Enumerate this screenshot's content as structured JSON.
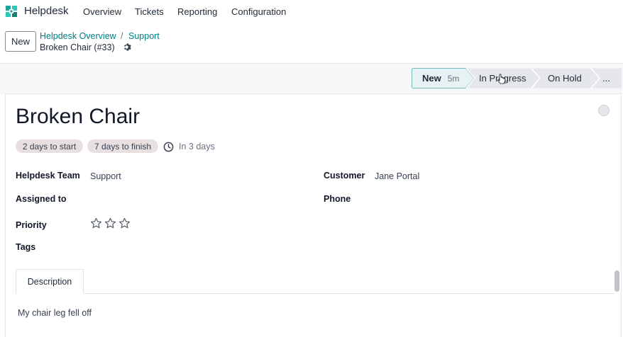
{
  "app": {
    "name": "Helpdesk"
  },
  "menu": [
    "Overview",
    "Tickets",
    "Reporting",
    "Configuration"
  ],
  "control_panel": {
    "new_label": "New",
    "breadcrumb": {
      "parent": "Helpdesk Overview",
      "separator": "/",
      "section": "Support",
      "current": "Broken Chair (#33)"
    }
  },
  "stages": {
    "new": {
      "label": "New",
      "duration": "5m"
    },
    "in_progress": "In Progress",
    "on_hold": "On Hold",
    "more": "..."
  },
  "ticket": {
    "title": "Broken Chair",
    "badges": [
      "2 days to start",
      "7 days to finish"
    ],
    "sla_deadline": "In 3 days",
    "fields": {
      "team_label": "Helpdesk Team",
      "team_value": "Support",
      "assigned_label": "Assigned to",
      "priority_label": "Priority",
      "tags_label": "Tags",
      "customer_label": "Customer",
      "customer_value": "Jane Portal",
      "phone_label": "Phone"
    },
    "priority_stars": 3,
    "priority_filled": 0
  },
  "tabs": {
    "description": "Description"
  },
  "description": "My chair leg fell off",
  "colors": {
    "brand": "#017e84",
    "stage_active_bg": "#e6f2f3",
    "stage_bg": "#e5e7eb"
  }
}
